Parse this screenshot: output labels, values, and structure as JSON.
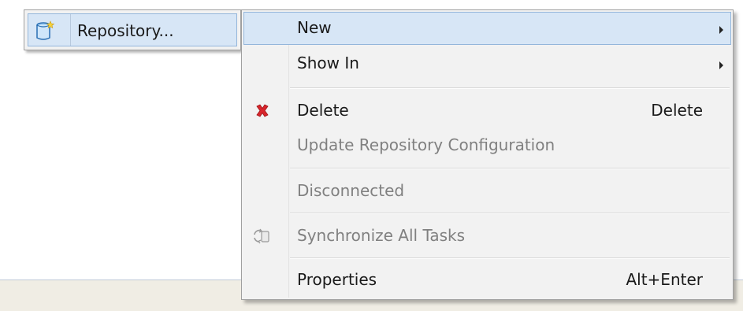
{
  "submenu": {
    "items": [
      {
        "label": "Repository...",
        "icon": "new-repository-icon"
      }
    ]
  },
  "context_menu": {
    "items": [
      {
        "label": "New",
        "submenu": true,
        "highlighted": true
      },
      {
        "label": "Show In",
        "submenu": true
      },
      {
        "label": "Delete",
        "accelerator": "Delete",
        "icon": "delete-red-x-icon"
      },
      {
        "label": "Update Repository Configuration",
        "disabled": true
      },
      {
        "label": "Disconnected",
        "disabled": true
      },
      {
        "label": "Synchronize All Tasks",
        "disabled": true,
        "icon": "synchronize-icon"
      },
      {
        "label": "Properties",
        "accelerator": "Alt+Enter"
      }
    ]
  },
  "colors": {
    "highlight_bg": "#d7e6f6",
    "highlight_border": "#94b6db",
    "menu_bg": "#f2f2f2",
    "disabled_text": "#808080",
    "delete_icon": "#d8262c"
  }
}
